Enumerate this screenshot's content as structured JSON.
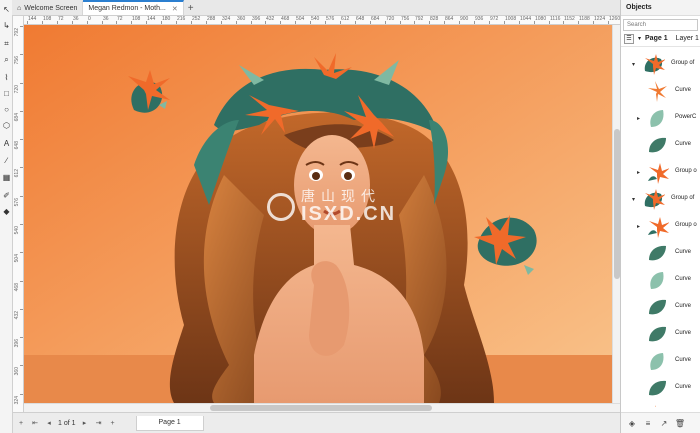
{
  "tabs": [
    {
      "label": "Welcome Screen",
      "active": false
    },
    {
      "label": "Megan Redmon - Moth...",
      "active": true
    }
  ],
  "ruler": {
    "h_ticks": [
      "144",
      "108",
      "72",
      "36",
      "0",
      "36",
      "72",
      "108",
      "144",
      "180",
      "216",
      "252",
      "288",
      "324",
      "360",
      "396",
      "432",
      "468",
      "504",
      "540",
      "576",
      "612",
      "648",
      "684",
      "720",
      "756",
      "792",
      "828",
      "864",
      "900",
      "936",
      "972",
      "1008",
      "1044",
      "1080",
      "1116",
      "1152",
      "1188",
      "1224",
      "1260"
    ],
    "v_ticks": [
      "792",
      "756",
      "720",
      "684",
      "648",
      "612",
      "576",
      "540",
      "504",
      "468",
      "432",
      "396",
      "360",
      "324"
    ]
  },
  "watermark": {
    "latin": "ISXD.CN",
    "chinese": "唐山现代"
  },
  "status": {
    "page_info": "1 of 1",
    "page_tab": "Page 1"
  },
  "objects": {
    "title": "Objects",
    "search_placeholder": "Search",
    "page_label": "Page 1",
    "layer_label": "Layer 1",
    "items": [
      {
        "label": "Group of",
        "indent": 1,
        "expanded": true,
        "thumb": "lily"
      },
      {
        "label": "Curve",
        "indent": 2,
        "expanded": null,
        "thumb": "petal-orange"
      },
      {
        "label": "PowerC",
        "indent": 2,
        "expanded": false,
        "thumb": "leaf-light"
      },
      {
        "label": "Curve",
        "indent": 2,
        "expanded": null,
        "thumb": "leaf-dark"
      },
      {
        "label": "Group o",
        "indent": 2,
        "expanded": false,
        "thumb": "lily-small"
      },
      {
        "label": "Group of",
        "indent": 1,
        "expanded": true,
        "thumb": "lily"
      },
      {
        "label": "Group o",
        "indent": 2,
        "expanded": false,
        "thumb": "lily-small"
      },
      {
        "label": "Curve",
        "indent": 2,
        "expanded": null,
        "thumb": "leaf-dark"
      },
      {
        "label": "Curve",
        "indent": 2,
        "expanded": null,
        "thumb": "leaf-light"
      },
      {
        "label": "Curve",
        "indent": 2,
        "expanded": null,
        "thumb": "leaf-dark"
      },
      {
        "label": "Curve",
        "indent": 2,
        "expanded": null,
        "thumb": "leaf-dark"
      },
      {
        "label": "Curve",
        "indent": 2,
        "expanded": null,
        "thumb": "leaf-light"
      },
      {
        "label": "Curve",
        "indent": 2,
        "expanded": null,
        "thumb": "leaf-dark"
      },
      {
        "label": "",
        "indent": 2,
        "expanded": null,
        "thumb": "petal-orange"
      }
    ]
  },
  "colors": {
    "canvas_bg": "#f5a862",
    "hair_dark": "#7a3e1c",
    "hair_mid": "#b4622a",
    "leaf_dark": "#2f6f63",
    "leaf_light": "#7fb9a2",
    "flower": "#f06a2a",
    "accent": "#2b7fd0"
  }
}
